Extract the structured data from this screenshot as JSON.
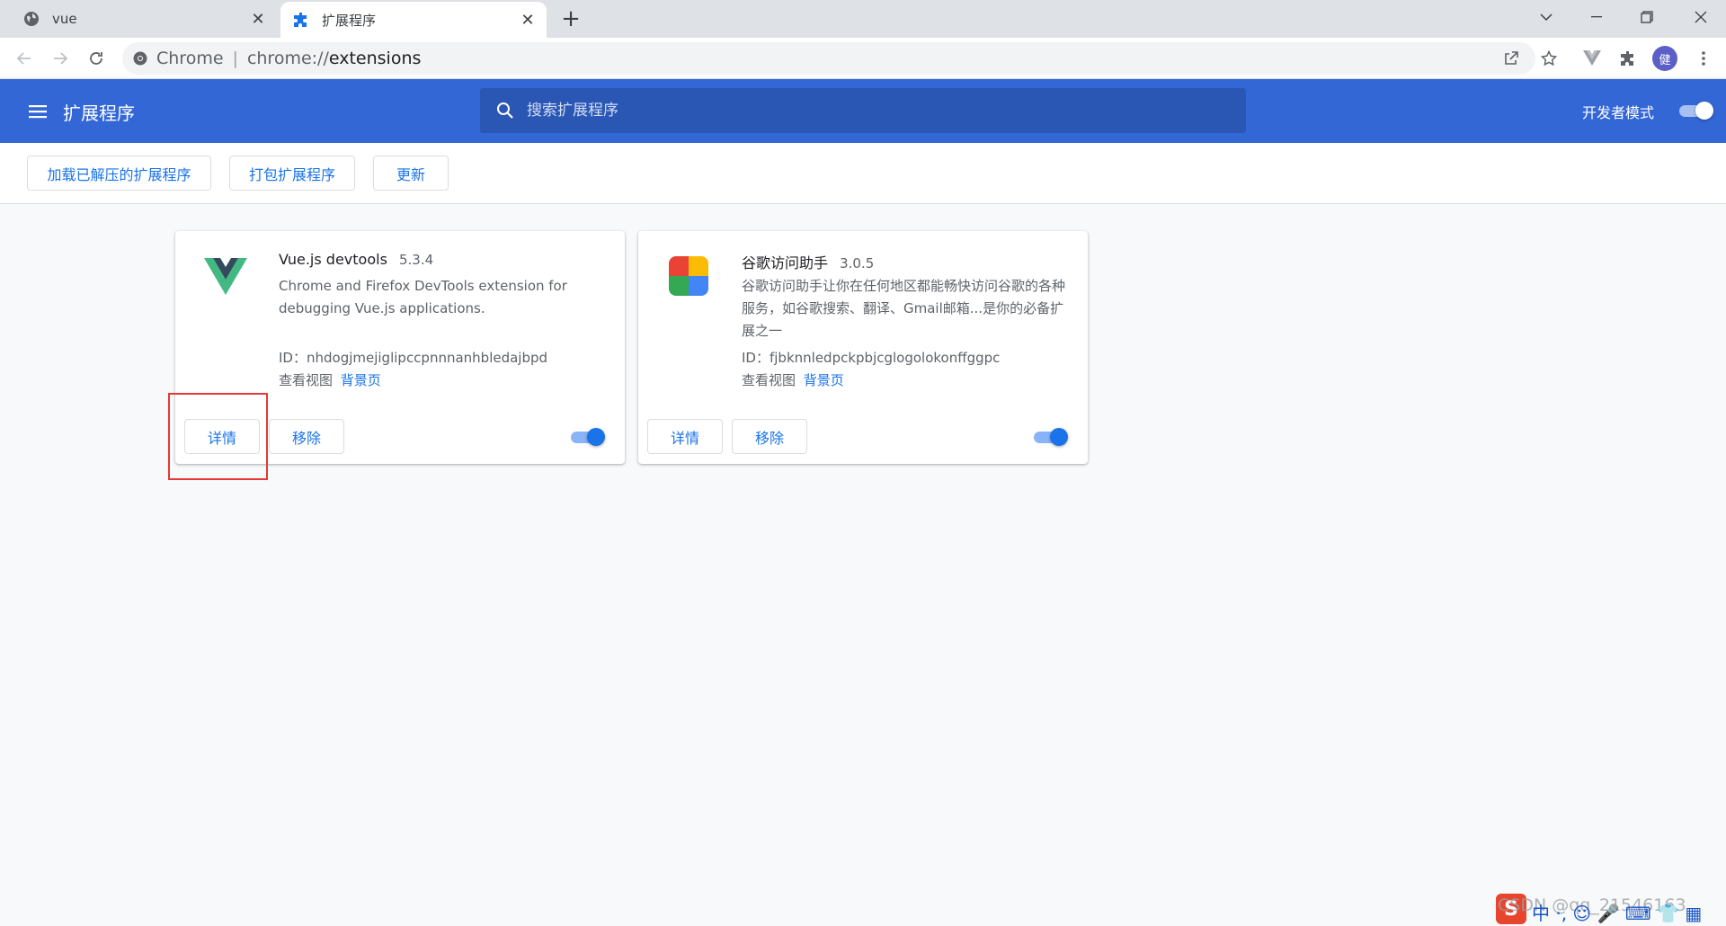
{
  "browser": {
    "tabs": [
      {
        "title": "vue",
        "icon": "globe-icon",
        "active": false
      },
      {
        "title": "扩展程序",
        "icon": "puzzle-icon",
        "active": true
      }
    ],
    "address": {
      "scheme": "Chrome",
      "separator": "|",
      "url_prefix": "chrome://",
      "url_path": "extensions"
    },
    "avatar_letter": "健"
  },
  "header": {
    "title": "扩展程序",
    "search_placeholder": "搜索扩展程序",
    "dev_mode_label": "开发者模式",
    "dev_mode_on": true
  },
  "actions": {
    "load_unpacked": "加载已解压的扩展程序",
    "pack": "打包扩展程序",
    "update": "更新"
  },
  "extensions": [
    {
      "name": "Vue.js devtools",
      "version": "5.3.4",
      "description": "Chrome and Firefox DevTools extension for debugging Vue.js applications.",
      "id_label": "ID：",
      "id": "nhdogjmejiglipccpnnnanhbledajbpd",
      "views_label": "查看视图",
      "views_link": "背景页",
      "details": "详情",
      "remove": "移除",
      "enabled": true,
      "icon": "vue-logo-icon"
    },
    {
      "name": "谷歌访问助手",
      "version": "3.0.5",
      "description": "谷歌访问助手让你在任何地区都能畅快访问谷歌的各种服务，如谷歌搜索、翻译、Gmail邮箱...是你的必备扩展之一",
      "id_label": "ID：",
      "id": "fjbknnledpckpbjcglogolokonffggpc",
      "views_label": "查看视图",
      "views_link": "背景页",
      "details": "详情",
      "remove": "移除",
      "enabled": true,
      "icon": "google-helper-icon"
    }
  ],
  "watermark": "CSDN @qq_21546163",
  "ime_text": "中 ·, ☺ 🎤 ⌨ 👕 ▦",
  "colors": {
    "header_blue": "#3367d6",
    "accent": "#1a73e8",
    "highlight_red": "#e53935"
  }
}
